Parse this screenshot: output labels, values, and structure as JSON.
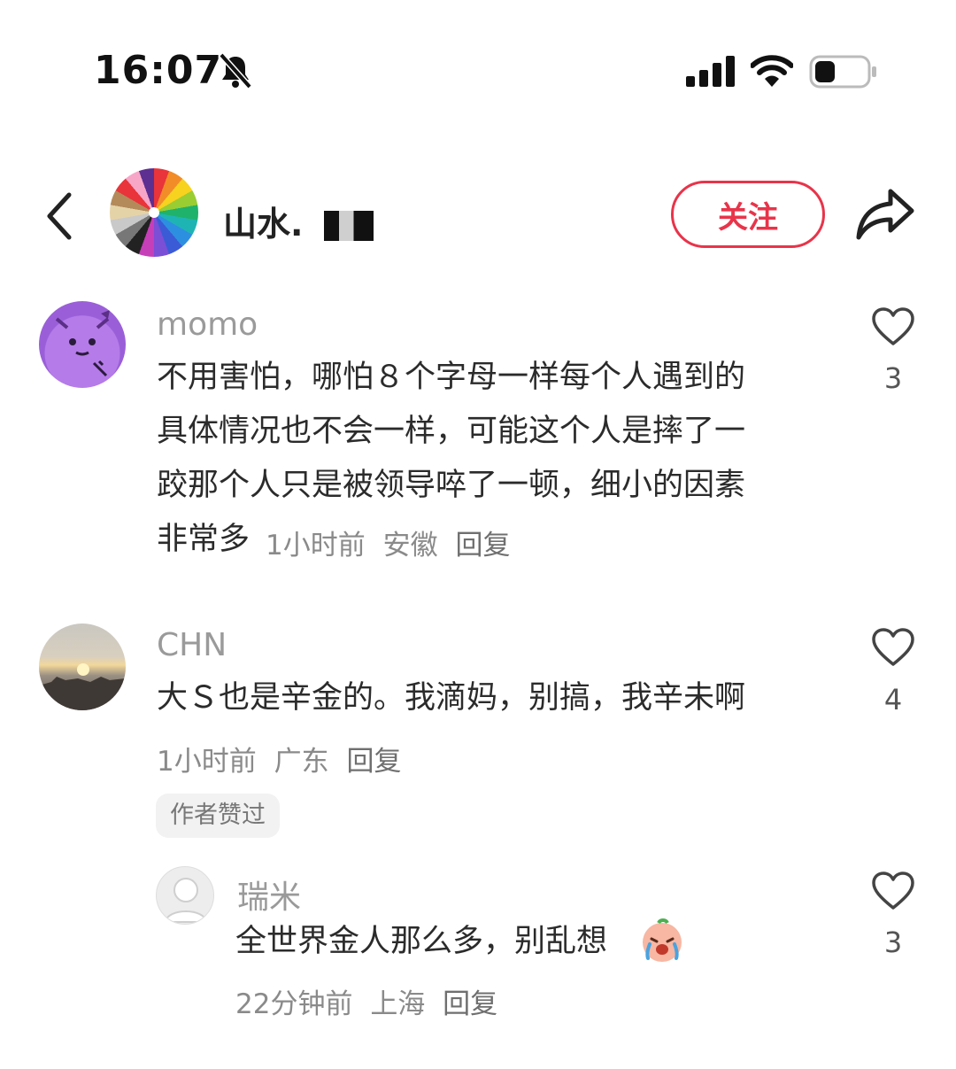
{
  "status_bar": {
    "time": "16:07"
  },
  "header": {
    "title": "山水.",
    "follow_label": "关注"
  },
  "comments": [
    {
      "name": "momo",
      "text": "不用害怕，哪怕８个字母一样每个人遇到的\n具体情况也不会一样，可能这个人是摔了一\n跤那个人只是被领导啐了一顿，细小的因素\n非常多",
      "time": "1小时前",
      "location": "安徽",
      "reply": "回复",
      "likes": "3"
    },
    {
      "name": "CHN",
      "text": "大Ｓ也是辛金的。我滴妈，别搞，我辛未啊",
      "time": "1小时前",
      "location": "广东",
      "reply": "回复",
      "likes": "4",
      "badge": "作者赞过"
    },
    {
      "name": "瑞米",
      "text": "全世界金人那么多，别乱想",
      "time": "22分钟前",
      "location": "上海",
      "reply": "回复",
      "likes": "3"
    }
  ]
}
